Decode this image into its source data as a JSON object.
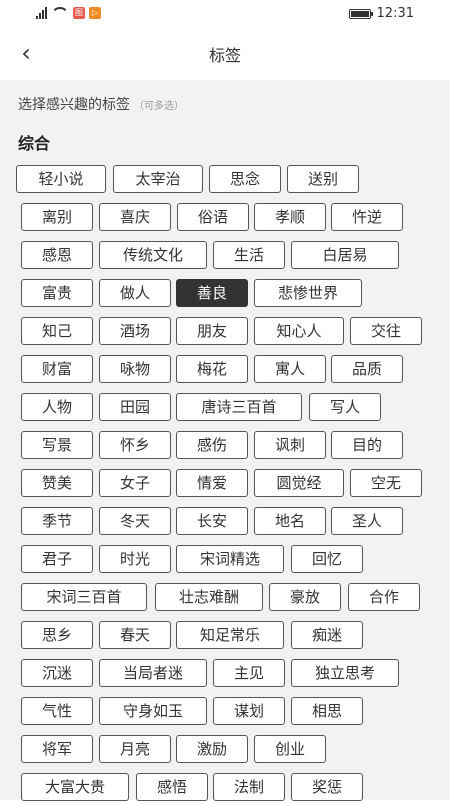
{
  "status_bar": {
    "time": "12:31",
    "app_icon_1": "图",
    "app_icon_2": "▷",
    "colors": {
      "app_icon_1": "#e85a4f",
      "app_icon_2": "#f08a24"
    }
  },
  "nav": {
    "back_icon": "‹",
    "title": "标签"
  },
  "hint": {
    "text": "选择感兴趣的标签",
    "sub": "（可多选）"
  },
  "section": {
    "title": "综合"
  },
  "selected_color": "#333333",
  "tags": [
    {
      "label": "轻小说"
    },
    {
      "label": "太宰治"
    },
    {
      "label": "思念"
    },
    {
      "label": "送别"
    },
    {
      "label": "离别"
    },
    {
      "label": "喜庆"
    },
    {
      "label": "俗语"
    },
    {
      "label": "孝顺"
    },
    {
      "label": "忤逆"
    },
    {
      "label": "感恩"
    },
    {
      "label": "传统文化"
    },
    {
      "label": "生活"
    },
    {
      "label": "白居易"
    },
    {
      "label": "富贵"
    },
    {
      "label": "做人"
    },
    {
      "label": "善良",
      "selected": true
    },
    {
      "label": "悲惨世界"
    },
    {
      "label": "知己"
    },
    {
      "label": "酒场"
    },
    {
      "label": "朋友"
    },
    {
      "label": "知心人"
    },
    {
      "label": "交往"
    },
    {
      "label": "财富"
    },
    {
      "label": "咏物"
    },
    {
      "label": "梅花"
    },
    {
      "label": "寓人"
    },
    {
      "label": "品质"
    },
    {
      "label": "人物"
    },
    {
      "label": "田园"
    },
    {
      "label": "唐诗三百首"
    },
    {
      "label": "写人"
    },
    {
      "label": "写景"
    },
    {
      "label": "怀乡"
    },
    {
      "label": "感伤"
    },
    {
      "label": "讽刺"
    },
    {
      "label": "目的"
    },
    {
      "label": "赞美"
    },
    {
      "label": "女子"
    },
    {
      "label": "情爱"
    },
    {
      "label": "圆觉经"
    },
    {
      "label": "空无"
    },
    {
      "label": "季节"
    },
    {
      "label": "冬天"
    },
    {
      "label": "长安"
    },
    {
      "label": "地名"
    },
    {
      "label": "圣人"
    },
    {
      "label": "君子"
    },
    {
      "label": "时光"
    },
    {
      "label": "宋词精选"
    },
    {
      "label": "回忆"
    },
    {
      "label": "宋词三百首"
    },
    {
      "label": "壮志难酬"
    },
    {
      "label": "豪放"
    },
    {
      "label": "合作"
    },
    {
      "label": "思乡"
    },
    {
      "label": "春天"
    },
    {
      "label": "知足常乐"
    },
    {
      "label": "痴迷"
    },
    {
      "label": "沉迷"
    },
    {
      "label": "当局者迷"
    },
    {
      "label": "主见"
    },
    {
      "label": "独立思考"
    },
    {
      "label": "气性"
    },
    {
      "label": "守身如玉"
    },
    {
      "label": "谋划"
    },
    {
      "label": "相思"
    },
    {
      "label": "将军"
    },
    {
      "label": "月亮"
    },
    {
      "label": "激励"
    },
    {
      "label": "创业"
    },
    {
      "label": "大富大贵"
    },
    {
      "label": "感悟"
    },
    {
      "label": "法制"
    },
    {
      "label": "奖惩"
    }
  ]
}
